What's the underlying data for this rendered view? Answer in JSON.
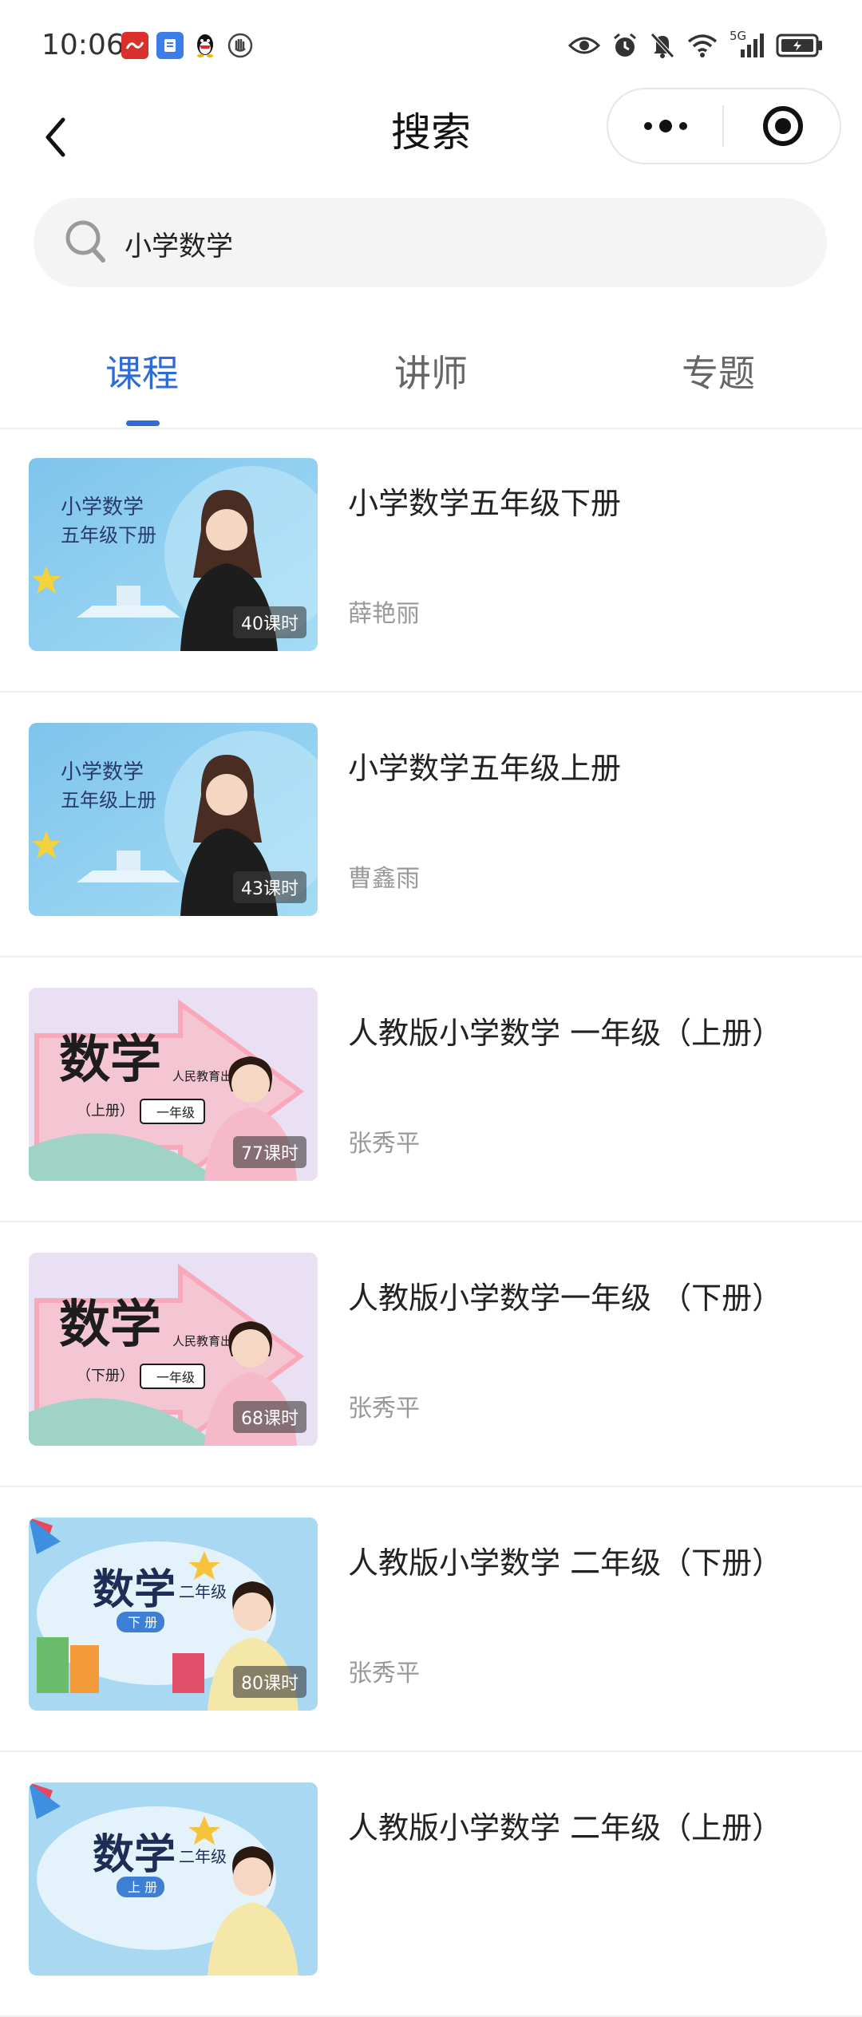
{
  "status_bar": {
    "time": "10:06",
    "network": "5G",
    "app_icons": [
      "app-red-icon",
      "app-blue-icon",
      "qq-penguin-icon",
      "hand-icon"
    ],
    "system_icons": [
      "eye-icon",
      "alarm-icon",
      "mute-bell-icon",
      "wifi-icon",
      "signal-icon",
      "battery-icon"
    ]
  },
  "navbar": {
    "title": "搜索"
  },
  "search": {
    "value": "小学数学"
  },
  "tabs": [
    {
      "label": "课程",
      "active": true
    },
    {
      "label": "讲师",
      "active": false
    },
    {
      "label": "专题",
      "active": false
    }
  ],
  "courses": [
    {
      "title": "小学数学五年级下册",
      "teacher": "薛艳丽",
      "lessons": "40课时",
      "thumb_text": "小学数学\n五年级下册",
      "thumb_style": "blue-lecture"
    },
    {
      "title": "小学数学五年级上册",
      "teacher": "曹鑫雨",
      "lessons": "43课时",
      "thumb_text": "小学数学\n五年级上册",
      "thumb_style": "blue-lecture"
    },
    {
      "title": "人教版小学数学 一年级（上册）",
      "teacher": "张秀平",
      "lessons": "77课时",
      "thumb_text": "数学",
      "thumb_sub": "（上册）",
      "thumb_grade": "一年级",
      "thumb_publisher": "人民教育出",
      "thumb_style": "pink-arrow"
    },
    {
      "title": "人教版小学数学一年级 （下册）",
      "teacher": "张秀平",
      "lessons": "68课时",
      "thumb_text": "数学",
      "thumb_sub": "（下册）",
      "thumb_grade": "一年级",
      "thumb_publisher": "人民教育出",
      "thumb_style": "pink-arrow"
    },
    {
      "title": "人教版小学数学 二年级（下册）",
      "teacher": "张秀平",
      "lessons": "80课时",
      "thumb_text": "数学",
      "thumb_sub": "下 册",
      "thumb_grade": "二年级",
      "thumb_style": "cloud"
    },
    {
      "title": "人教版小学数学 二年级（上册）",
      "teacher": "",
      "lessons": "",
      "thumb_text": "数学",
      "thumb_sub": "上 册",
      "thumb_grade": "二年级",
      "thumb_style": "cloud"
    }
  ],
  "colors": {
    "accent": "#2f6bd4",
    "tab_inactive": "#666666",
    "teacher_text": "#999999"
  }
}
